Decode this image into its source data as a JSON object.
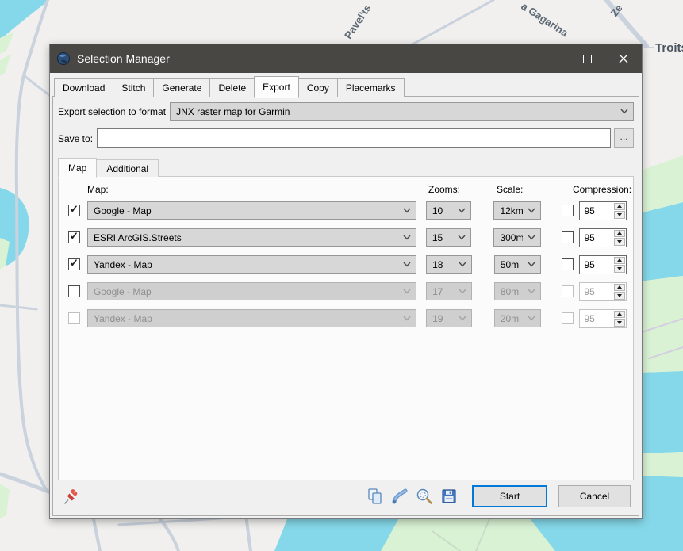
{
  "window": {
    "title": "Selection Manager"
  },
  "main_tabs": [
    {
      "label": "Download",
      "active": false
    },
    {
      "label": "Stitch",
      "active": false
    },
    {
      "label": "Generate",
      "active": false
    },
    {
      "label": "Delete",
      "active": false
    },
    {
      "label": "Export",
      "active": true
    },
    {
      "label": "Copy",
      "active": false
    },
    {
      "label": "Placemarks",
      "active": false
    }
  ],
  "format_row": {
    "label": "Export selection to format",
    "value": "JNX raster map for Garmin"
  },
  "save_row": {
    "label": "Save to:",
    "value": "",
    "browse": "..."
  },
  "sub_tabs": [
    {
      "label": "Map",
      "active": true
    },
    {
      "label": "Additional",
      "active": false
    }
  ],
  "headers": {
    "map": "Map:",
    "zooms": "Zooms:",
    "scale": "Scale:",
    "compression": "Compression:"
  },
  "rows": [
    {
      "checked": true,
      "row_enabled": true,
      "lead_checkbox_enabled": true,
      "map": "Google - Map",
      "zoom": "10",
      "scale": "12km",
      "overlay_checked": false,
      "compression": "95"
    },
    {
      "checked": true,
      "row_enabled": true,
      "lead_checkbox_enabled": true,
      "map": "ESRI ArcGIS.Streets",
      "zoom": "15",
      "scale": "300m",
      "overlay_checked": false,
      "compression": "95"
    },
    {
      "checked": true,
      "row_enabled": true,
      "lead_checkbox_enabled": true,
      "map": "Yandex - Map",
      "zoom": "18",
      "scale": "50m",
      "overlay_checked": false,
      "compression": "95"
    },
    {
      "checked": false,
      "row_enabled": false,
      "lead_checkbox_enabled": true,
      "map": "Google - Map",
      "zoom": "17",
      "scale": "80m",
      "overlay_checked": false,
      "compression": "95"
    },
    {
      "checked": false,
      "row_enabled": false,
      "lead_checkbox_enabled": false,
      "map": "Yandex - Map",
      "zoom": "19",
      "scale": "20m",
      "overlay_checked": false,
      "compression": "95"
    }
  ],
  "footer": {
    "start": "Start",
    "cancel": "Cancel",
    "icons": [
      "pin-icon",
      "copy-icon",
      "route-icon",
      "zoom-selection-icon",
      "save-icon"
    ]
  },
  "map_labels": {
    "street1": "Pavel'ts",
    "street2": "a Gagarina",
    "street3": "Ze",
    "street4": "Troits"
  },
  "colors": {
    "titlebar": "#484744",
    "accent": "#0078d7",
    "water": "#85d8e9",
    "park": "#d9f2d4",
    "road": "#c9d2dd"
  }
}
